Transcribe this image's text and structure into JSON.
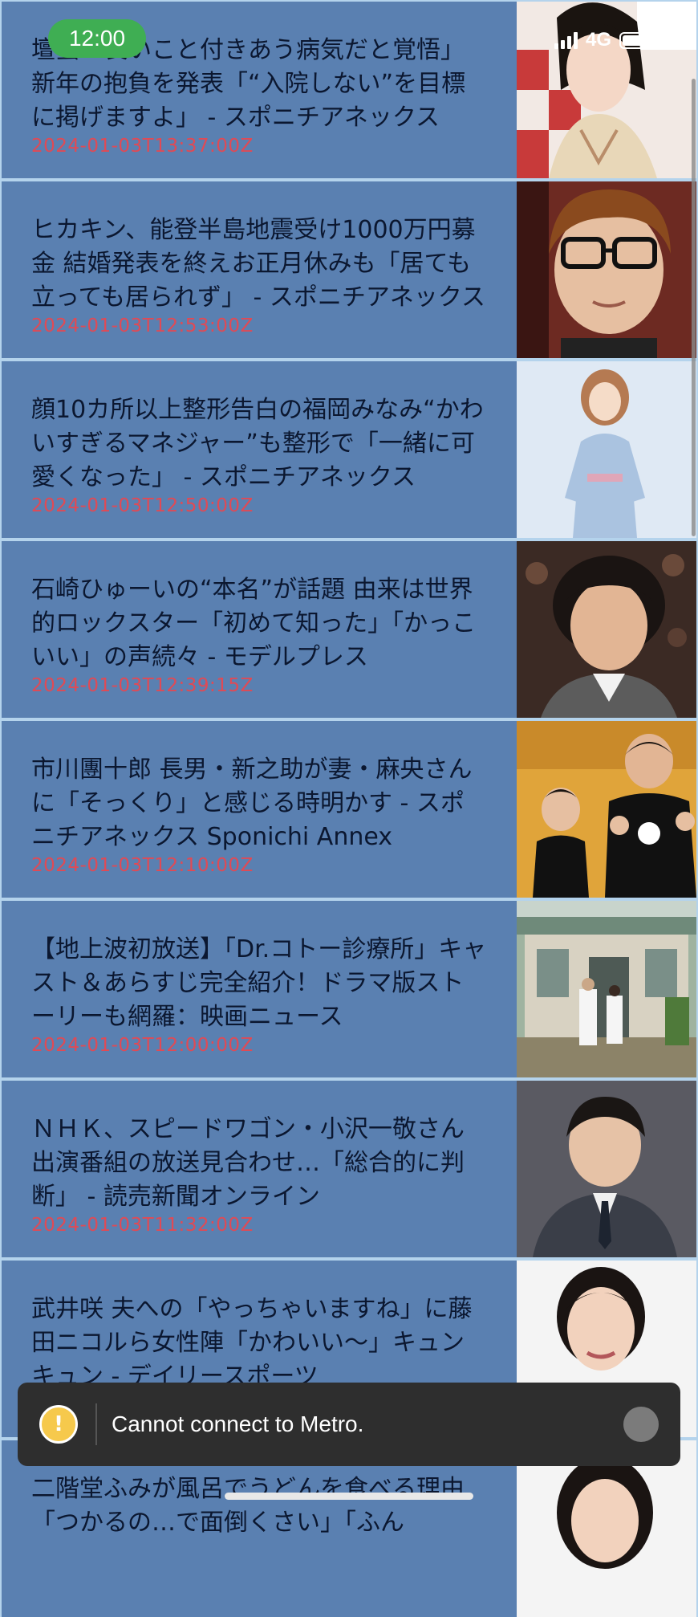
{
  "status_bar": {
    "time": "12:00",
    "network": "4G"
  },
  "news": [
    {
      "title": "壇蜜「長いこと付きあう病気だと覚悟」新年の抱負を発表「“入院しない”を目標に掲げますよ」 - スポニチアネックス",
      "date": "2024-01-03T13:37:00Z",
      "thumb_icon": "woman-in-kimono-photo"
    },
    {
      "title": "ヒカキン、能登半島地震受け1000万円募金 結婚発表を終えお正月休みも「居ても立っても居られず」 - スポニチアネックス",
      "date": "2024-01-03T12:53:00Z",
      "thumb_icon": "man-with-glasses-photo"
    },
    {
      "title": "顔10カ所以上整形告白の福岡みなみ“かわいすぎるマネジャー”も整形で「一緒に可愛くなった」 - スポニチアネックス",
      "date": "2024-01-03T12:50:00Z",
      "thumb_icon": "woman-posing-photo"
    },
    {
      "title": "石崎ひゅーいの“本名”が話題 由来は世界的ロックスター「初めて知った」「かっこいい」の声続々 - モデルプレス",
      "date": "2024-01-03T12:39:15Z",
      "thumb_icon": "curly-hair-man-photo"
    },
    {
      "title": "市川團十郎 長男・新之助が妻・麻央さんに「そっくり」と感じる時明かす - スポニチアネックス Sponichi Annex",
      "date": "2024-01-03T12:10:00Z",
      "thumb_icon": "father-and-son-photo"
    },
    {
      "title": "【地上波初放送】「Dr.コトー診療所」キャスト＆あらすじ完全紹介！ドラマ版ストーリーも網羅：映画ニュース",
      "date": "2024-01-03T12:00:00Z",
      "thumb_icon": "clinic-building-photo"
    },
    {
      "title": "ＮＨＫ、スピードワゴン・小沢一敬さん出演番組の放送見合わせ…「総合的に判断」 - 読売新聞オンライン",
      "date": "2024-01-03T11:32:00Z",
      "thumb_icon": "man-in-suit-photo"
    },
    {
      "title": "武井咲 夫への「やっちゃいますね」に藤田ニコルら女性陣「かわいい〜」キュンキュン - デイリースポーツ",
      "date": "",
      "thumb_icon": "smiling-woman-photo"
    },
    {
      "title": "二階堂ふみが風呂でうどんを食べる理由「つかるの…で面倒くさい」「ふん",
      "date": "",
      "thumb_icon": "woman-portrait-photo"
    }
  ],
  "toast": {
    "message": "Cannot connect to Metro.",
    "icon": "warning-icon"
  },
  "colors": {
    "item_background": "#5a80b1",
    "separator": "#b4d3ec",
    "date_text": "#e04a55",
    "title_text": "#0b1730"
  }
}
